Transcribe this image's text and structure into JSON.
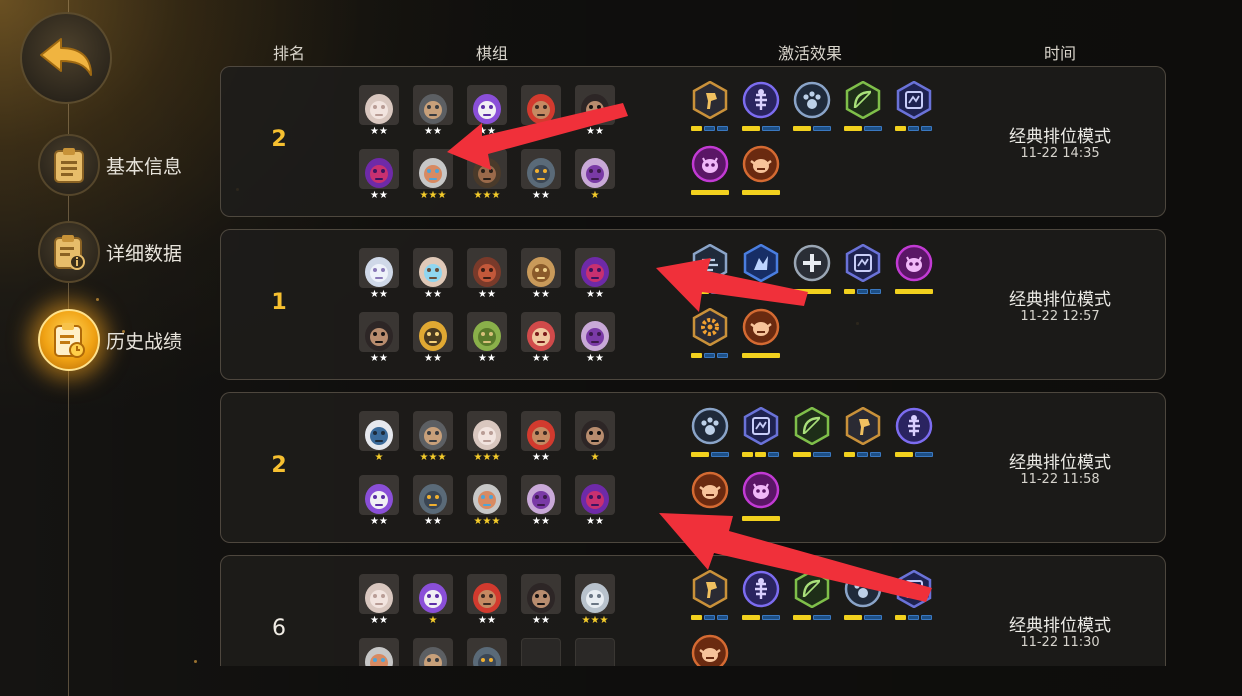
{
  "nav": {
    "back_icon": "back-arrow-icon",
    "items": [
      {
        "label": "基本信息",
        "icon": "clipboard-icon",
        "active": false
      },
      {
        "label": "详细数据",
        "icon": "clipboard-info-icon",
        "active": false
      },
      {
        "label": "历史战绩",
        "icon": "clipboard-history-icon",
        "active": true
      }
    ]
  },
  "headers": {
    "rank": "排名",
    "lineup": "棋组",
    "traits": "激活效果",
    "time": "时间"
  },
  "colors": {
    "accent_gold": "#f6c030",
    "star_gold": "#f5cc2a",
    "star_white": "#ffffff",
    "trait_bar_active": "#f2d11e",
    "trait_bar_inactive": "#1d4f86",
    "annotation_red": "#f0303a"
  },
  "matches": [
    {
      "rank": "2",
      "highlight": true,
      "mode": "经典排位模式",
      "time": "11-22 14:35",
      "heroes": [
        {
          "name": "pig-hero",
          "stars": "★★",
          "gold": false
        },
        {
          "name": "hooded-archer-hero",
          "stars": "★★",
          "gold": false
        },
        {
          "name": "purple-hair-hero",
          "stars": "★★",
          "gold": false
        },
        {
          "name": "red-bandana-hero",
          "stars": "★★",
          "gold": false
        },
        {
          "name": "dark-swordsman-hero",
          "stars": "★★",
          "gold": false
        },
        {
          "name": "purple-demon-hero",
          "stars": "★★",
          "gold": false
        },
        {
          "name": "goggles-dwarf-hero",
          "stars": "★★★",
          "gold": true
        },
        {
          "name": "bearded-warrior-hero",
          "stars": "★★★",
          "gold": true
        },
        {
          "name": "robot-hero",
          "stars": "★★",
          "gold": false
        },
        {
          "name": "masked-assassin-hero",
          "stars": "★",
          "gold": true
        }
      ],
      "traits": [
        {
          "icon": "axe-icon",
          "frame": "#c9913a",
          "fill": "#2a2a33",
          "glyph": "#f0c060",
          "levels": [
            1,
            0,
            0
          ]
        },
        {
          "icon": "fish-bone-icon",
          "frame": "#7c6cf0",
          "fill": "#2a2460",
          "glyph": "#d9d0ff",
          "levels": [
            1,
            0
          ]
        },
        {
          "icon": "paw-icon",
          "frame": "#8aa4c8",
          "fill": "#1f2a3a",
          "glyph": "#bcd0e8",
          "levels": [
            1,
            0
          ]
        },
        {
          "icon": "bow-icon",
          "frame": "#7fbf4a",
          "fill": "#1e2e18",
          "glyph": "#a9e07a",
          "levels": [
            1,
            0
          ]
        },
        {
          "icon": "spellbook-icon",
          "frame": "#6a72d8",
          "fill": "#1e2250",
          "glyph": "#c8cdf8",
          "levels": [
            1,
            0,
            0
          ]
        },
        {
          "icon": "demon-icon",
          "frame": "#c23ad4",
          "fill": "#5a1666",
          "glyph": "#f0b8f8",
          "levels": [
            1
          ]
        },
        {
          "icon": "goblin-icon",
          "frame": "#d46a32",
          "fill": "#6a2a10",
          "glyph": "#f7c39a",
          "levels": [
            1
          ]
        }
      ]
    },
    {
      "rank": "1",
      "highlight": true,
      "mode": "经典排位模式",
      "time": "11-22 12:57",
      "heroes": [
        {
          "name": "ghost-hero",
          "stars": "★★",
          "gold": false
        },
        {
          "name": "horned-beast-hero",
          "stars": "★★",
          "gold": false
        },
        {
          "name": "bull-warrior-hero",
          "stars": "★★",
          "gold": false
        },
        {
          "name": "tree-ent-hero",
          "stars": "★★",
          "gold": false
        },
        {
          "name": "purple-demon-hero",
          "stars": "★★",
          "gold": false
        },
        {
          "name": "dark-swordsman-hero",
          "stars": "★★",
          "gold": false
        },
        {
          "name": "gold-monk-hero",
          "stars": "★★",
          "gold": false
        },
        {
          "name": "green-goblin-hero",
          "stars": "★★",
          "gold": false
        },
        {
          "name": "red-owl-hero",
          "stars": "★★",
          "gold": false
        },
        {
          "name": "masked-assassin-hero",
          "stars": "★★",
          "gold": false
        }
      ],
      "traits": [
        {
          "icon": "wind-icon",
          "frame": "#8aa4c8",
          "fill": "#1f2a3a",
          "glyph": "#bcd0e8",
          "levels": [
            1,
            0
          ]
        },
        {
          "icon": "dragon-icon",
          "frame": "#4a7ee0",
          "fill": "#172e66",
          "glyph": "#bcd4ff",
          "levels": [
            1,
            0
          ]
        },
        {
          "icon": "cross-icon",
          "frame": "#9aa6b4",
          "fill": "#2a2e36",
          "glyph": "#e8ecf2",
          "levels": [
            1
          ]
        },
        {
          "icon": "spellbook-icon",
          "frame": "#6a72d8",
          "fill": "#1e2250",
          "glyph": "#c8cdf8",
          "levels": [
            1,
            0,
            0
          ]
        },
        {
          "icon": "demon-icon",
          "frame": "#c23ad4",
          "fill": "#5a1666",
          "glyph": "#f0b8f8",
          "levels": [
            1
          ]
        },
        {
          "icon": "gear-icon",
          "frame": "#c9913a",
          "fill": "#2a2a33",
          "glyph": "#f0a030",
          "levels": [
            1,
            0,
            0
          ]
        },
        {
          "icon": "goblin-icon",
          "frame": "#d46a32",
          "fill": "#6a2a10",
          "glyph": "#f7c39a",
          "levels": [
            1
          ]
        }
      ]
    },
    {
      "rank": "2",
      "highlight": true,
      "mode": "经典排位模式",
      "time": "11-22 11:58",
      "heroes": [
        {
          "name": "white-hair-elf-hero",
          "stars": "★",
          "gold": true
        },
        {
          "name": "hooded-archer-hero",
          "stars": "★★★",
          "gold": true
        },
        {
          "name": "pig-hero",
          "stars": "★★★",
          "gold": true
        },
        {
          "name": "red-bandana-hero",
          "stars": "★★",
          "gold": false
        },
        {
          "name": "dark-swordsman-hero",
          "stars": "★",
          "gold": true
        },
        {
          "name": "purple-hair-hero",
          "stars": "★★",
          "gold": false
        },
        {
          "name": "robot-hero",
          "stars": "★★",
          "gold": false
        },
        {
          "name": "goggles-dwarf-hero",
          "stars": "★★★",
          "gold": true
        },
        {
          "name": "masked-assassin-hero",
          "stars": "★★",
          "gold": false
        },
        {
          "name": "purple-demon-hero",
          "stars": "★★",
          "gold": false
        }
      ],
      "traits": [
        {
          "icon": "paw-icon",
          "frame": "#8aa4c8",
          "fill": "#1f2a3a",
          "glyph": "#bcd0e8",
          "levels": [
            1,
            0
          ]
        },
        {
          "icon": "spellbook-icon",
          "frame": "#6a72d8",
          "fill": "#1e2250",
          "glyph": "#c8cdf8",
          "levels": [
            1,
            1,
            0
          ]
        },
        {
          "icon": "bow-icon",
          "frame": "#7fbf4a",
          "fill": "#1e2e18",
          "glyph": "#a9e07a",
          "levels": [
            1,
            0
          ]
        },
        {
          "icon": "axe-icon",
          "frame": "#c9913a",
          "fill": "#2a2a33",
          "glyph": "#f0c060",
          "levels": [
            1,
            0,
            0
          ]
        },
        {
          "icon": "fish-bone-icon",
          "frame": "#7c6cf0",
          "fill": "#2a2460",
          "glyph": "#d9d0ff",
          "levels": [
            1,
            0
          ]
        },
        {
          "icon": "goblin-icon",
          "frame": "#d46a32",
          "fill": "#6a2a10",
          "glyph": "#f7c39a",
          "levels": [
            1
          ]
        },
        {
          "icon": "demon-icon",
          "frame": "#c23ad4",
          "fill": "#5a1666",
          "glyph": "#f0b8f8",
          "levels": [
            1
          ]
        }
      ]
    },
    {
      "rank": "6",
      "highlight": false,
      "mode": "经典排位模式",
      "time": "11-22 11:30",
      "heroes": [
        {
          "name": "pig-hero",
          "stars": "★★",
          "gold": false
        },
        {
          "name": "purple-hair-hero",
          "stars": "★",
          "gold": true
        },
        {
          "name": "red-bandana-hero",
          "stars": "★★",
          "gold": false
        },
        {
          "name": "dark-swordsman-hero",
          "stars": "★★",
          "gold": false
        },
        {
          "name": "grey-yeti-hero",
          "stars": "★★★",
          "gold": true
        },
        {
          "name": "goggles-dwarf-hero",
          "stars": "",
          "gold": false
        },
        {
          "name": "hooded-archer-hero",
          "stars": "",
          "gold": false
        },
        {
          "name": "robot-hero",
          "stars": "",
          "gold": false
        },
        {
          "name": "empty-slot",
          "stars": "",
          "gold": false
        },
        {
          "name": "empty-slot",
          "stars": "",
          "gold": false
        }
      ],
      "traits": [
        {
          "icon": "axe-icon",
          "frame": "#c9913a",
          "fill": "#2a2a33",
          "glyph": "#f0c060",
          "levels": [
            1,
            0,
            0
          ]
        },
        {
          "icon": "fish-bone-icon",
          "frame": "#7c6cf0",
          "fill": "#2a2460",
          "glyph": "#d9d0ff",
          "levels": [
            1,
            0
          ]
        },
        {
          "icon": "bow-icon",
          "frame": "#7fbf4a",
          "fill": "#1e2e18",
          "glyph": "#a9e07a",
          "levels": [
            1,
            0
          ]
        },
        {
          "icon": "paw-icon",
          "frame": "#8aa4c8",
          "fill": "#1f2a3a",
          "glyph": "#bcd0e8",
          "levels": [
            1,
            0
          ]
        },
        {
          "icon": "spellbook-icon",
          "frame": "#6a72d8",
          "fill": "#1e2250",
          "glyph": "#c8cdf8",
          "levels": [
            1,
            0,
            0
          ]
        },
        {
          "icon": "goblin-icon",
          "frame": "#d46a32",
          "fill": "#6a2a10",
          "glyph": "#f7c39a",
          "levels": [
            1
          ]
        }
      ]
    }
  ]
}
